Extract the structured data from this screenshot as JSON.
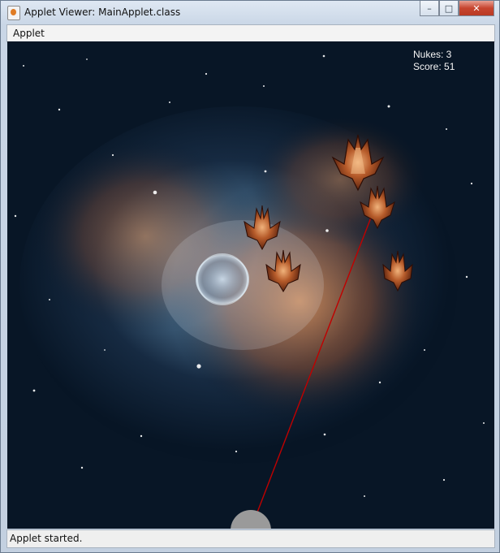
{
  "window": {
    "title": "Applet Viewer: MainApplet.class"
  },
  "menu": {
    "items": [
      "Applet"
    ]
  },
  "hud": {
    "nukes_label": "Nukes: 3",
    "score_label": "Score: 51"
  },
  "status": {
    "text": "Applet started."
  },
  "colors": {
    "laser": "#c00000",
    "turret": "#9a9a9a"
  },
  "game": {
    "enemies": [
      {
        "type": "enemy-ship-large"
      },
      {
        "type": "enemy-ship"
      },
      {
        "type": "enemy-ship"
      },
      {
        "type": "enemy-ship"
      },
      {
        "type": "enemy-ship"
      }
    ]
  }
}
